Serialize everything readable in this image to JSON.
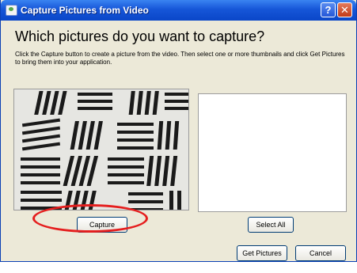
{
  "window": {
    "title": "Capture Pictures from Video",
    "help_label": "?",
    "close_label": "✕",
    "icons": {
      "app": "camera-app-icon",
      "help": "help-icon",
      "close": "close-icon"
    }
  },
  "dialog": {
    "heading": "Which pictures do you want to capture?",
    "instructions": "Click the Capture button to create a picture from the video.  Then select one or more thumbnails and click Get Pictures to bring them into your application."
  },
  "buttons": {
    "capture": "Capture",
    "select_all": "Select All",
    "get_pictures": "Get Pictures",
    "cancel": "Cancel"
  },
  "colors": {
    "titlebar": "#0a46c8",
    "dialog_bg": "#ece9d8",
    "annotation": "#e51e1e"
  }
}
